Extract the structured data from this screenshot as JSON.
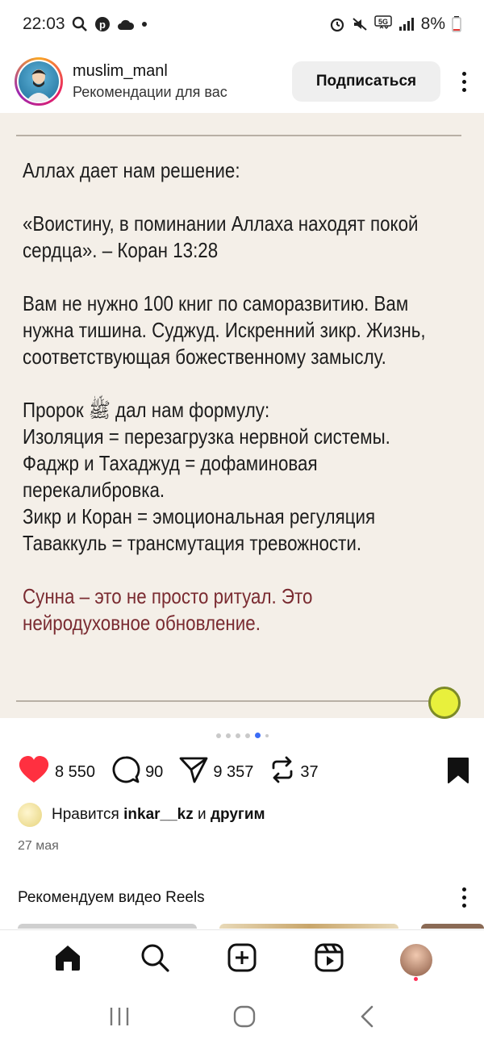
{
  "status_bar": {
    "time": "22:03",
    "battery": "8%",
    "network": "5G"
  },
  "post": {
    "username": "muslim_manl",
    "subtitle": "Рекомендации для вас",
    "subscribe_label": "Подписаться",
    "content": {
      "para1": "Аллах дает нам решение:",
      "para2": "«Воистину, в поминании Аллаха находят покой\nсердца». – Коран 13:28",
      "para3": "Вам не нужно 100 книг по саморазвитию. Вам\nнужна тишина. Суджуд. Искренний зикр. Жизнь,\nсоответствующая божественному замыслу.",
      "para4": "Пророк ﷺ дал нам формулу:\nИзоляция = перезагрузка нервной системы.\nФаджр и Тахаджуд = дофаминовая\nперекалибровка.\nЗикр и Коран = эмоциональная регуляция\nТаваккуль = трансмутация тревожности.",
      "para5": "Сунна – это не просто ритуал. Это\nнейродуховное обновление."
    },
    "carousel": {
      "total": 6,
      "active_index": 4
    },
    "actions": {
      "likes": "8 550",
      "comments": "90",
      "shares": "9 357",
      "reposts": "37"
    },
    "liked_by": {
      "prefix": "Нравится",
      "user": "inkar__kz",
      "middle": "и",
      "suffix": "другим"
    },
    "date": "27 мая"
  },
  "reels": {
    "title": "Рекомендуем видео Reels"
  },
  "colors": {
    "like_red": "#ff3040",
    "accent_text": "#7a2b31",
    "post_background": "#f4efe8",
    "active_dot": "#3b6cf6"
  },
  "icons": {
    "status": [
      "search-icon",
      "pinterest-icon",
      "cloud-icon",
      "alarm-icon",
      "mute-icon",
      "signal-icon",
      "battery-icon"
    ],
    "actions": [
      "heart-icon",
      "comment-icon",
      "send-icon",
      "repost-icon",
      "bookmark-icon"
    ],
    "tabs": [
      "home-icon",
      "search-icon",
      "add-icon",
      "reels-icon",
      "profile-avatar"
    ],
    "system": [
      "recents-icon",
      "home-circle-icon",
      "back-icon"
    ]
  }
}
